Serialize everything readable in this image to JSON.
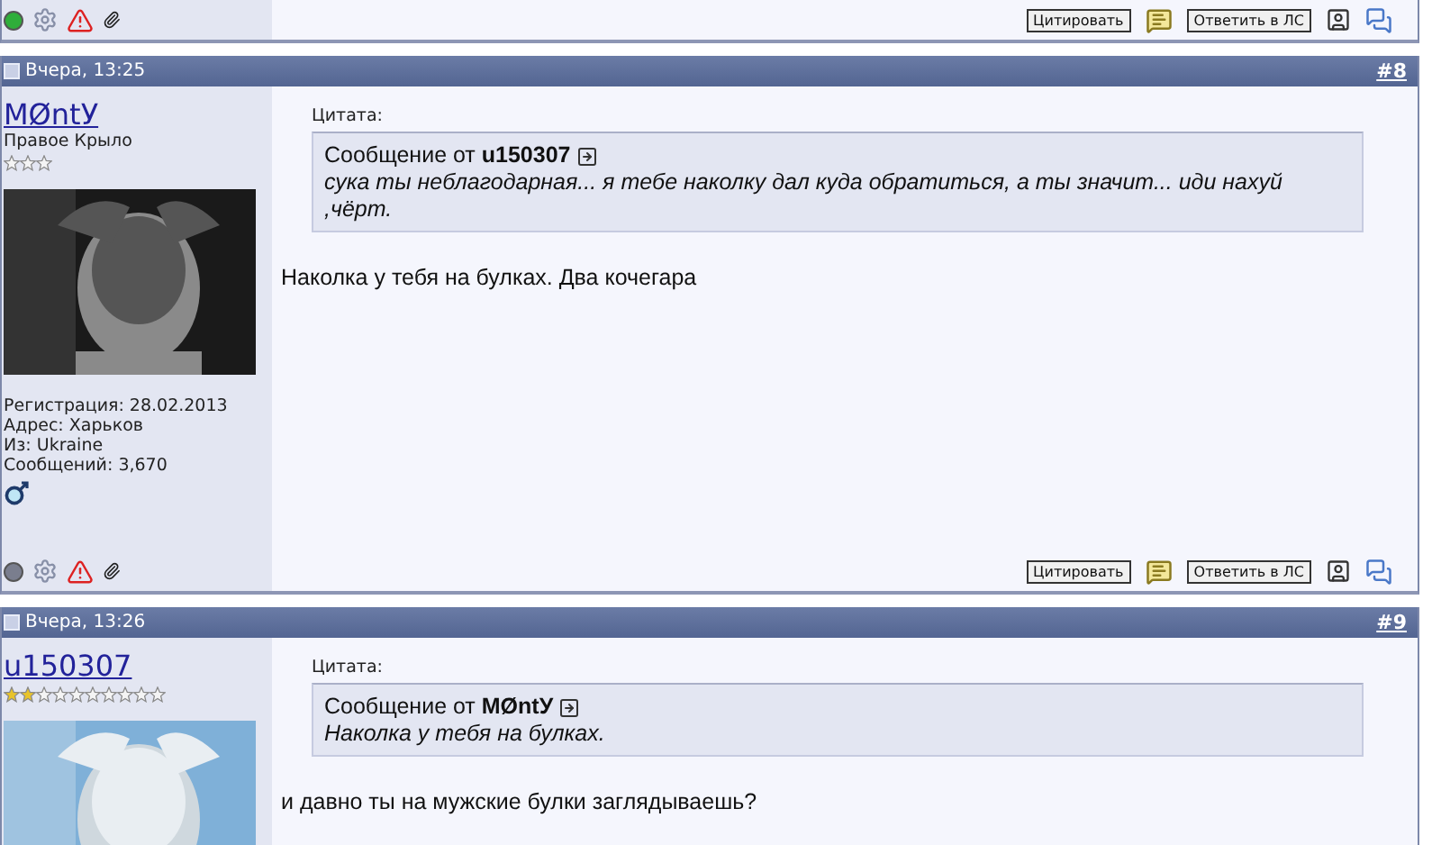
{
  "posts": [
    {
      "kind": "footer_only",
      "footer": {
        "online": true,
        "buttons": [
          "Цитировать",
          "Ответить в ЛС"
        ]
      }
    },
    {
      "kind": "full",
      "date": "Вчера, 13:25",
      "number": "#8",
      "user": {
        "name": "MØntУ",
        "title": "Правое Крыло",
        "rank": {
          "kind": "short",
          "stars": 0
        },
        "info": [
          "Регистрация: 28.02.2013",
          "Адрес: Харьков",
          "Из: Ukraine",
          "Сообщений: 3,670"
        ],
        "badge": {
          "kind": "male"
        }
      },
      "quote": {
        "label": "Цитата:",
        "prefix": "Сообщение от",
        "author": "u150307",
        "text": "сука ты неблагодарная... я тебе наколку дал куда обратиться, а ты значит... иди нахуй ,чёрт."
      },
      "message": "Наколка у тебя на булках. Два кочегара",
      "footer": {
        "online": false,
        "buttons": [
          "Цитировать",
          "Ответить в ЛС"
        ]
      }
    },
    {
      "kind": "full",
      "date": "Вчера, 13:26",
      "number": "#9",
      "user": {
        "name": "u150307",
        "rank": {
          "kind": "long",
          "stars": 2
        }
      },
      "quote": {
        "label": "Цитата:",
        "prefix": "Сообщение от",
        "author": "MØntУ",
        "text": "Наколка у тебя на булках."
      },
      "message": "и давно ты на мужские булки заглядываешь?"
    }
  ]
}
